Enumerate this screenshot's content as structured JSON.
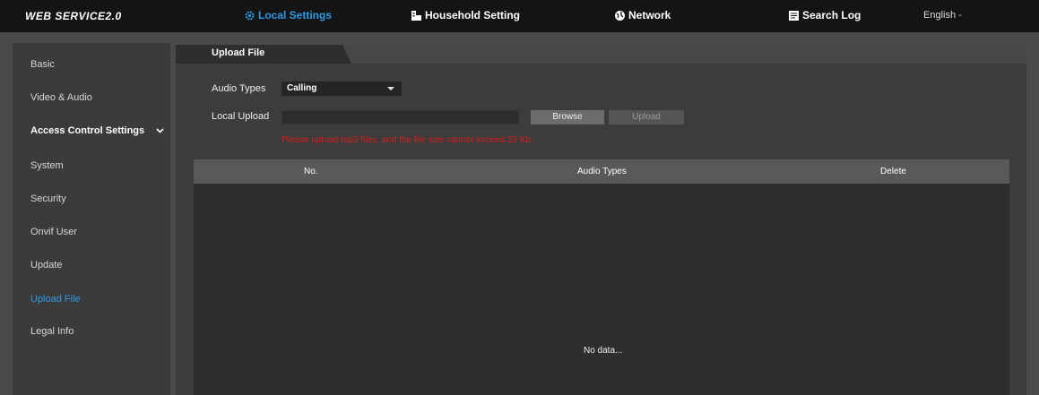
{
  "header": {
    "logo": "WEB SERVICE2.0",
    "nav": [
      {
        "label": "Local Settings",
        "icon": "gear-icon",
        "active": true
      },
      {
        "label": "Household Setting",
        "icon": "building-icon",
        "active": false
      },
      {
        "label": "Network",
        "icon": "globe-icon",
        "active": false
      },
      {
        "label": "Search Log",
        "icon": "document-icon",
        "active": false
      }
    ],
    "language": "English -"
  },
  "sidebar": {
    "items": [
      {
        "label": "Basic"
      },
      {
        "label": "Video & Audio"
      },
      {
        "label": "Access Control Settings",
        "expandable": true
      },
      {
        "label": "System"
      },
      {
        "label": "Security"
      },
      {
        "label": "Onvif User"
      },
      {
        "label": "Update"
      },
      {
        "label": "Upload File",
        "active": true
      },
      {
        "label": "Legal Info"
      }
    ]
  },
  "main": {
    "tab": "Upload File",
    "form": {
      "audio_types_label": "Audio Types",
      "audio_types_value": "Calling",
      "local_upload_label": "Local Upload",
      "local_upload_value": "",
      "browse_label": "Browse",
      "upload_label": "Upload",
      "warning": "Please upload mp3 files, and the file size cannot exceed 20 Kb."
    },
    "table": {
      "columns": [
        "No.",
        "Audio Types",
        "Delete"
      ],
      "rows": [],
      "empty_text": "No data..."
    }
  },
  "colors": {
    "accent": "#2e9ae6",
    "warning": "#d81c1c",
    "topbar": "#141414"
  }
}
